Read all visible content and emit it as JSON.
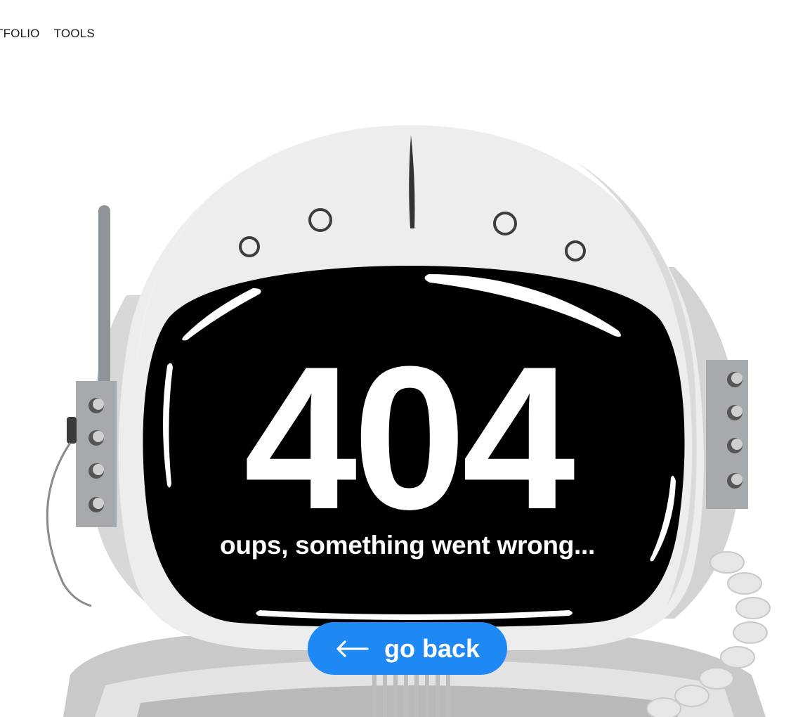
{
  "nav": {
    "items": [
      {
        "label": "TFOLIO"
      },
      {
        "label": "TOOLS"
      }
    ]
  },
  "error": {
    "code": "404",
    "message": "oups, something went wrong..."
  },
  "back_button": {
    "label": "go back",
    "icon": "arrow-left-icon"
  },
  "illustration": {
    "name": "astronaut-helmet",
    "visor_color": "#000000"
  },
  "colors": {
    "accent": "#1e88f4",
    "helmet_light": "#ededed",
    "helmet_shade": "#d4d4d4",
    "metal": "#8f9498",
    "text": "#1a1a1a"
  }
}
